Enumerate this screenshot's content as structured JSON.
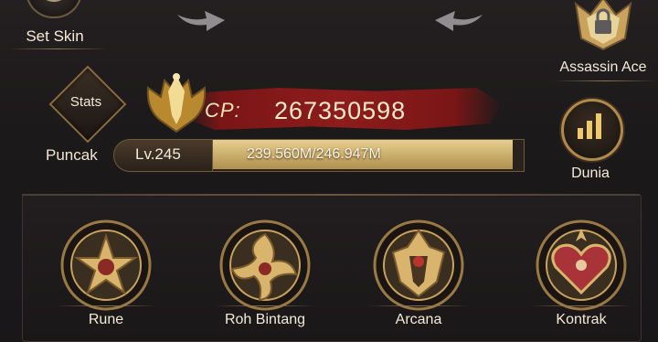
{
  "top": {
    "set_skin_label": "Set Skin",
    "emblem_label": "Assassin Ace"
  },
  "stats": {
    "label": "Stats"
  },
  "cp": {
    "label": "CP:",
    "value": "267350598"
  },
  "level": {
    "rank_label": "Puncak",
    "level_text": "Lv.245",
    "exp_text": "239.560M/246.947M",
    "exp_progress": 0.97
  },
  "world": {
    "label": "Dunia"
  },
  "slots": [
    {
      "label": "Rune",
      "icon": "rune-star-icon"
    },
    {
      "label": "Roh Bintang",
      "icon": "star-spirit-icon"
    },
    {
      "label": "Arcana",
      "icon": "arcana-helm-icon"
    },
    {
      "label": "Kontrak",
      "icon": "contract-heart-icon"
    }
  ],
  "colors": {
    "gold": "#c9ac6a",
    "cp_red": "#8e1c1c",
    "background": "#1c191a"
  }
}
